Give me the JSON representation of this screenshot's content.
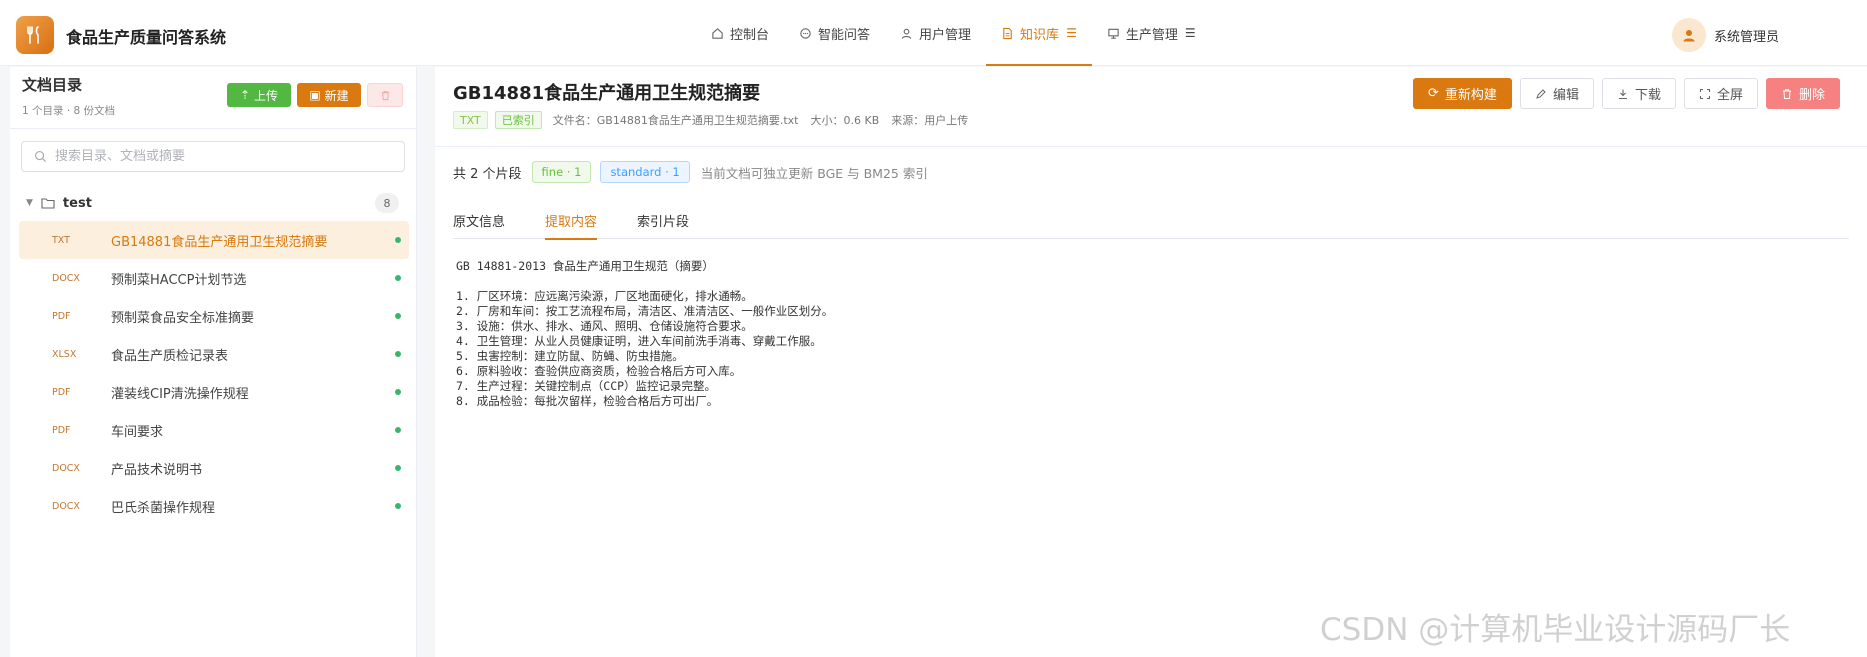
{
  "app": {
    "title": "食品生产质量问答系统",
    "accent": "#d9790f"
  },
  "nav": {
    "items": [
      {
        "label": "控制台",
        "icon": "home-icon"
      },
      {
        "label": "智能问答",
        "icon": "chat-icon"
      },
      {
        "label": "用户管理",
        "icon": "user-icon"
      },
      {
        "label": "知识库",
        "icon": "document-icon",
        "active": true
      },
      {
        "label": "生产管理",
        "icon": "monitor-icon"
      }
    ]
  },
  "user": {
    "name": "系统管理员"
  },
  "sidebar": {
    "title": "文档目录",
    "subtitle": "1 个目录 · 8 份文档",
    "upload_label": "上传",
    "new_label": "新建",
    "search_placeholder": "搜索目录、文档或摘要",
    "folder": {
      "name": "test",
      "count": "8"
    },
    "docs": [
      {
        "type": "TXT",
        "name": "GB14881食品生产通用卫生规范摘要",
        "active": true
      },
      {
        "type": "DOCX",
        "name": "预制菜HACCP计划节选"
      },
      {
        "type": "PDF",
        "name": "预制菜食品安全标准摘要"
      },
      {
        "type": "XLSX",
        "name": "食品生产质检记录表"
      },
      {
        "type": "PDF",
        "name": "灌装线CIP清洗操作规程"
      },
      {
        "type": "PDF",
        "name": "车间要求"
      },
      {
        "type": "DOCX",
        "name": "产品技术说明书"
      },
      {
        "type": "DOCX",
        "name": "巴氏杀菌操作规程"
      }
    ]
  },
  "main": {
    "title": "GB14881食品生产通用卫生规范摘要",
    "tag_type": "TXT",
    "tag_indexed": "已索引",
    "file_name": "文件名：GB14881食品生产通用卫生规范摘要.txt",
    "size": "大小：0.6 KB",
    "source": "来源：用户上传",
    "actions": {
      "rebuild": "重新构建",
      "edit": "编辑",
      "download": "下载",
      "fullscreen": "全屏",
      "delete": "删除"
    },
    "segments": {
      "total": "共 2 个片段",
      "fine": "fine · 1",
      "standard": "standard · 1",
      "note": "当前文档可独立更新 BGE 与 BM25 索引"
    },
    "tabs": [
      "原文信息",
      "提取内容",
      "索引片段"
    ],
    "content": {
      "heading": "GB 14881-2013 食品生产通用卫生规范（摘要）",
      "lines": [
        "1. 厂区环境：应远离污染源，厂区地面硬化，排水通畅。",
        "2. 厂房和车间：按工艺流程布局，清洁区、准清洁区、一般作业区划分。",
        "3. 设施：供水、排水、通风、照明、仓储设施符合要求。",
        "4. 卫生管理：从业人员健康证明，进入车间前洗手消毒、穿戴工作服。",
        "5. 虫害控制：建立防鼠、防蝇、防虫措施。",
        "6. 原料验收：查验供应商资质，检验合格后方可入库。",
        "7. 生产过程：关键控制点（CCP）监控记录完整。",
        "8. 成品检验：每批次留样，检验合格后方可出厂。"
      ]
    }
  },
  "watermark": "CSDN @计算机毕业设计源码厂长"
}
